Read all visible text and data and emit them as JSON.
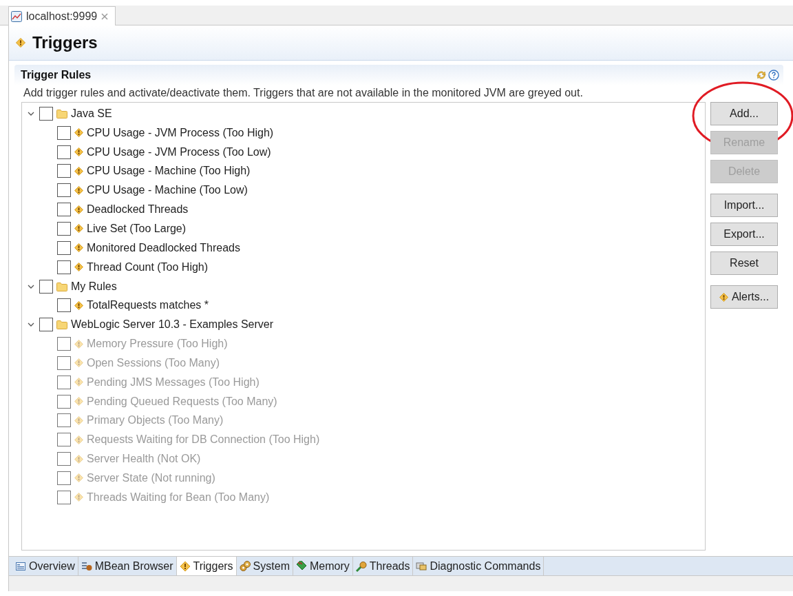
{
  "editor_tab": {
    "title": "localhost:9999"
  },
  "page": {
    "title": "Triggers"
  },
  "section": {
    "title": "Trigger Rules",
    "description": "Add trigger rules and activate/deactivate them. Triggers that are not available in the monitored JVM are greyed out."
  },
  "tree": [
    {
      "label": "Java SE",
      "expanded": true,
      "checked": false,
      "children": [
        {
          "label": "CPU Usage - JVM Process (Too High)",
          "checked": false,
          "disabled": false
        },
        {
          "label": "CPU Usage - JVM Process (Too Low)",
          "checked": false,
          "disabled": false
        },
        {
          "label": "CPU Usage - Machine (Too High)",
          "checked": false,
          "disabled": false
        },
        {
          "label": "CPU Usage - Machine (Too Low)",
          "checked": false,
          "disabled": false
        },
        {
          "label": "Deadlocked Threads",
          "checked": false,
          "disabled": false
        },
        {
          "label": "Live Set (Too Large)",
          "checked": false,
          "disabled": false
        },
        {
          "label": "Monitored Deadlocked Threads",
          "checked": false,
          "disabled": false
        },
        {
          "label": "Thread Count (Too High)",
          "checked": false,
          "disabled": false
        }
      ]
    },
    {
      "label": "My Rules",
      "expanded": true,
      "checked": false,
      "children": [
        {
          "label": "TotalRequests matches *",
          "checked": false,
          "disabled": false
        }
      ]
    },
    {
      "label": "WebLogic Server 10.3 - Examples Server",
      "expanded": true,
      "checked": false,
      "children": [
        {
          "label": "Memory Pressure (Too High)",
          "checked": false,
          "disabled": true
        },
        {
          "label": "Open Sessions (Too Many)",
          "checked": false,
          "disabled": true
        },
        {
          "label": "Pending JMS Messages (Too High)",
          "checked": false,
          "disabled": true
        },
        {
          "label": "Pending Queued Requests (Too Many)",
          "checked": false,
          "disabled": true
        },
        {
          "label": "Primary Objects (Too Many)",
          "checked": false,
          "disabled": true
        },
        {
          "label": "Requests Waiting for DB Connection (Too High)",
          "checked": false,
          "disabled": true
        },
        {
          "label": "Server Health (Not OK)",
          "checked": false,
          "disabled": true
        },
        {
          "label": "Server State (Not running)",
          "checked": false,
          "disabled": true
        },
        {
          "label": "Threads Waiting for Bean (Too Many)",
          "checked": false,
          "disabled": true
        }
      ]
    }
  ],
  "button_groups": [
    [
      {
        "label": "Add...",
        "kind": "plain",
        "disabled": false,
        "circled": true
      },
      {
        "label": "Rename",
        "kind": "plain",
        "disabled": true,
        "circled": false
      },
      {
        "label": "Delete",
        "kind": "plain",
        "disabled": true,
        "circled": false
      }
    ],
    [
      {
        "label": "Import...",
        "kind": "plain",
        "disabled": false,
        "circled": false
      },
      {
        "label": "Export...",
        "kind": "plain",
        "disabled": false,
        "circled": false
      },
      {
        "label": "Reset",
        "kind": "plain",
        "disabled": false,
        "circled": false
      }
    ],
    [
      {
        "label": "Alerts...",
        "kind": "icon",
        "disabled": false,
        "circled": false
      }
    ]
  ],
  "bottom_tabs": [
    {
      "label": "Overview",
      "kind": "overview",
      "selected": false
    },
    {
      "label": "MBean Browser",
      "kind": "mbean",
      "selected": false
    },
    {
      "label": "Triggers",
      "kind": "trigger",
      "selected": true
    },
    {
      "label": "System",
      "kind": "system",
      "selected": false
    },
    {
      "label": "Memory",
      "kind": "memory",
      "selected": false
    },
    {
      "label": "Threads",
      "kind": "threads",
      "selected": false
    },
    {
      "label": "Diagnostic Commands",
      "kind": "diagnostic",
      "selected": false
    }
  ]
}
